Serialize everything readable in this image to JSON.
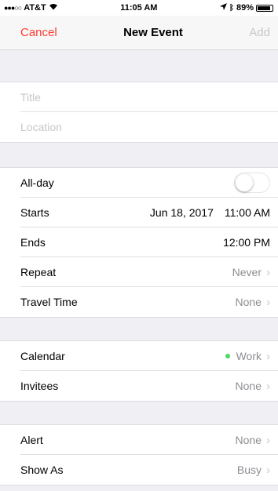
{
  "status": {
    "carrier": "AT&T",
    "time": "11:05 AM",
    "battery": "89%",
    "battery_level": 0.89
  },
  "nav": {
    "cancel": "Cancel",
    "title": "New Event",
    "add": "Add"
  },
  "fields": {
    "title_placeholder": "Title",
    "location_placeholder": "Location"
  },
  "rows": {
    "allday": {
      "label": "All-day",
      "on": false
    },
    "starts": {
      "label": "Starts",
      "date": "Jun 18, 2017",
      "time": "11:00 AM"
    },
    "ends": {
      "label": "Ends",
      "time": "12:00 PM"
    },
    "repeat": {
      "label": "Repeat",
      "value": "Never"
    },
    "travel": {
      "label": "Travel Time",
      "value": "None"
    },
    "calendar": {
      "label": "Calendar",
      "value": "Work",
      "dot_color": "#4cd964"
    },
    "invitees": {
      "label": "Invitees",
      "value": "None"
    },
    "alert": {
      "label": "Alert",
      "value": "None"
    },
    "showas": {
      "label": "Show As",
      "value": "Busy"
    }
  },
  "colors": {
    "accent": "#ff3b30",
    "disabled": "#c7c7cc",
    "secondary_text": "#8e8e93"
  }
}
